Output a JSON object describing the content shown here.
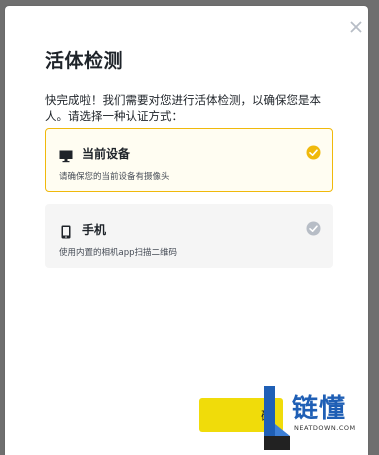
{
  "dialog": {
    "title": "活体检测",
    "description": "快完成啦！我们需要对您进行活体检测，以确保您是本人。请选择一种认证方式："
  },
  "options": [
    {
      "title": "当前设备",
      "subtitle": "请确保您的当前设备有摄像头",
      "icon": "monitor-icon",
      "selected": true
    },
    {
      "title": "手机",
      "subtitle": "使用内置的相机app扫描二维码",
      "icon": "phone-icon",
      "selected": false
    }
  ],
  "footer": {
    "primary_label": "确"
  },
  "watermark": {
    "brand": "链懂",
    "domain": "NEATDOWN.COM"
  },
  "colors": {
    "accent": "#f0b90b",
    "button": "#f0dc0a",
    "selected_bg": "#fffdf2",
    "option_bg": "#f5f5f5",
    "text": "#1e2329",
    "check_gray": "#b7bdc6",
    "brand_blue": "#1f5fb5"
  }
}
